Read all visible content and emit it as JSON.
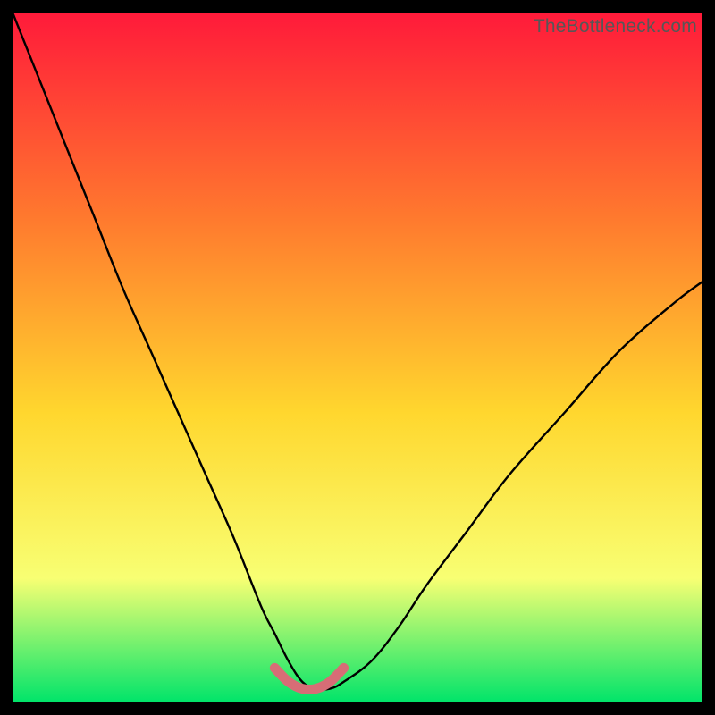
{
  "watermark": "TheBottleneck.com",
  "colors": {
    "gradient_top": "#ff1a3a",
    "gradient_mid1": "#ff7a2e",
    "gradient_mid2": "#ffd72e",
    "gradient_low": "#f8ff73",
    "gradient_bottom": "#00e46a",
    "curve": "#000000",
    "segment": "#d76d76",
    "frame": "#000000"
  },
  "chart_data": {
    "type": "line",
    "title": "",
    "xlabel": "",
    "ylabel": "",
    "xlim": [
      0,
      100
    ],
    "ylim": [
      0,
      100
    ],
    "x": [
      0,
      4,
      8,
      12,
      16,
      20,
      24,
      28,
      32,
      36,
      38,
      40,
      42,
      44,
      46,
      48,
      52,
      56,
      60,
      66,
      72,
      80,
      88,
      96,
      100
    ],
    "y": [
      100,
      90,
      80,
      70,
      60,
      51,
      42,
      33,
      24,
      14,
      10,
      6,
      3,
      2,
      2,
      3,
      6,
      11,
      17,
      25,
      33,
      42,
      51,
      58,
      61
    ],
    "highlight_segment": {
      "x": [
        38,
        40,
        42,
        44,
        46,
        48
      ],
      "y": [
        5,
        3,
        2,
        2,
        3,
        5
      ]
    }
  }
}
